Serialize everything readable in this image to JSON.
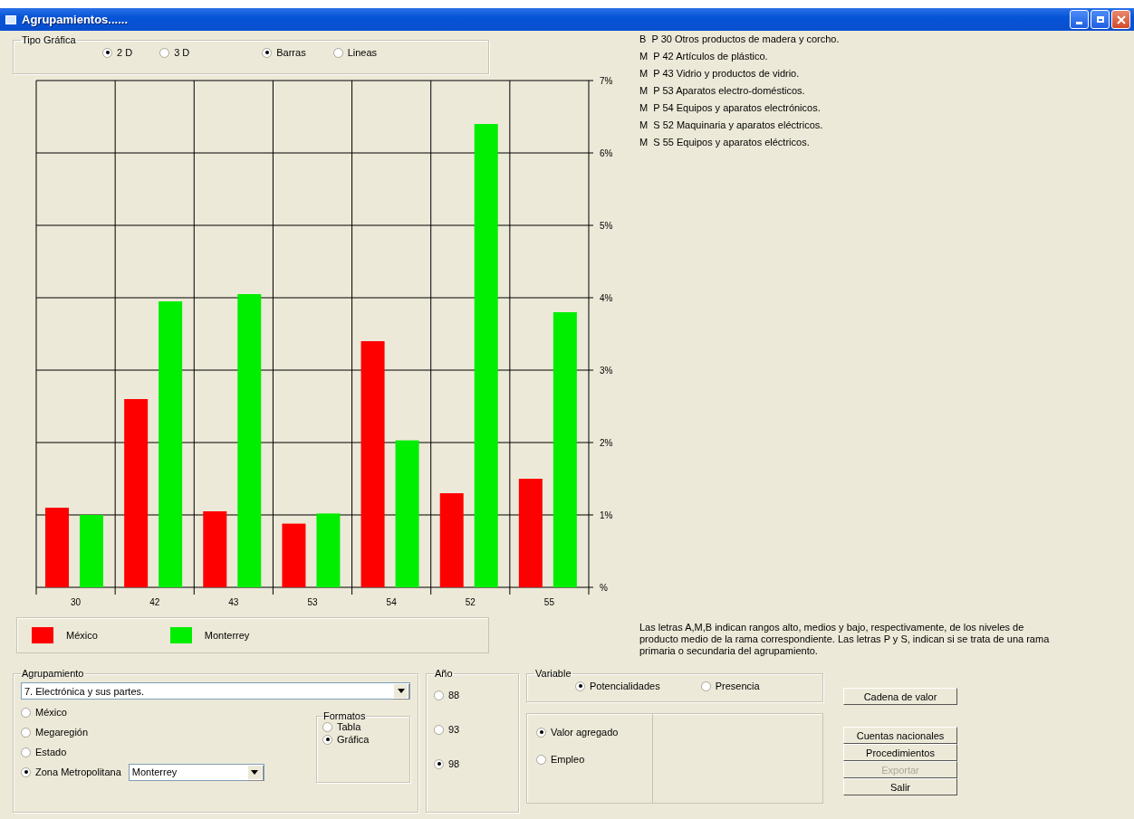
{
  "window": {
    "title": "Agrupamientos......"
  },
  "tipo_grafica": {
    "title": "Tipo Gráfica",
    "dimension": [
      {
        "label": "2 D",
        "selected": true
      },
      {
        "label": "3 D",
        "selected": false
      }
    ],
    "estilo": [
      {
        "label": "Barras",
        "selected": true
      },
      {
        "label": "Lineas",
        "selected": false
      }
    ]
  },
  "chart_data": {
    "type": "bar",
    "grid": true,
    "categories": [
      "30",
      "42",
      "43",
      "53",
      "54",
      "52",
      "55"
    ],
    "series": [
      {
        "name": "México",
        "color": "#ff0000",
        "values": [
          1.1,
          2.6,
          1.05,
          0.88,
          3.4,
          1.3,
          1.5
        ]
      },
      {
        "name": "Monterrey",
        "color": "#00ee00",
        "values": [
          1.0,
          3.95,
          4.05,
          1.02,
          2.03,
          6.4,
          3.8
        ]
      }
    ],
    "ylim": [
      0,
      7
    ],
    "yticks": [
      {
        "value": 0,
        "label": "%"
      },
      {
        "value": 1,
        "label": "1%"
      },
      {
        "value": 2,
        "label": "2%"
      },
      {
        "value": 3,
        "label": "3%"
      },
      {
        "value": 4,
        "label": "4%"
      },
      {
        "value": 5,
        "label": "5%"
      },
      {
        "value": 6,
        "label": "6%"
      },
      {
        "value": 7,
        "label": "7%"
      }
    ]
  },
  "descriptions": [
    "B  P 30 Otros productos de madera y corcho.",
    "M  P 42 Artículos de plástico.",
    "M  P 43 Vidrio y productos de vidrio.",
    "M  P 53 Aparatos electro-domésticos.",
    "M  P 54 Equipos y aparatos electrónicos.",
    "M  S 52 Maquinaria y aparatos eléctricos.",
    "M  S 55 Equipos y aparatos eléctricos."
  ],
  "note": "Las letras A,M,B indican rangos alto, medios y bajo, respectivamente,  de los niveles de producto medio de la rama correspondiente. Las letras P y S, indican si se trata de una rama primaria o secundaria del agrupamiento.",
  "agrupamiento": {
    "title": "Agrupamiento",
    "combo": "7. Electrónica y sus partes.",
    "regions": [
      {
        "label": "México",
        "selected": false
      },
      {
        "label": "Megaregión",
        "selected": false
      },
      {
        "label": "Estado",
        "selected": false
      },
      {
        "label": "Zona Metropolitana",
        "selected": true
      }
    ],
    "metro_combo": "Monterrey",
    "formatos": {
      "title": "Formatos",
      "options": [
        {
          "label": "Tabla",
          "selected": false
        },
        {
          "label": "Gráfica",
          "selected": true
        }
      ]
    }
  },
  "anio": {
    "title": "Año",
    "options": [
      {
        "label": "88",
        "selected": false
      },
      {
        "label": "93",
        "selected": false
      },
      {
        "label": "98",
        "selected": true
      }
    ]
  },
  "variable": {
    "title": "Variable",
    "options": [
      {
        "label": "Potencialidades",
        "selected": true
      },
      {
        "label": "Presencia",
        "selected": false
      }
    ]
  },
  "medida": [
    {
      "label": "Valor agregado",
      "selected": true
    },
    {
      "label": "Empleo",
      "selected": false
    }
  ],
  "buttons": [
    {
      "label": "Cadena de valor",
      "disabled": false
    },
    {
      "label": "Cuentas nacionales",
      "disabled": false
    },
    {
      "label": "Procedimientos",
      "disabled": false
    },
    {
      "label": "Exportar",
      "disabled": true
    },
    {
      "label": "Salir",
      "disabled": false
    }
  ]
}
